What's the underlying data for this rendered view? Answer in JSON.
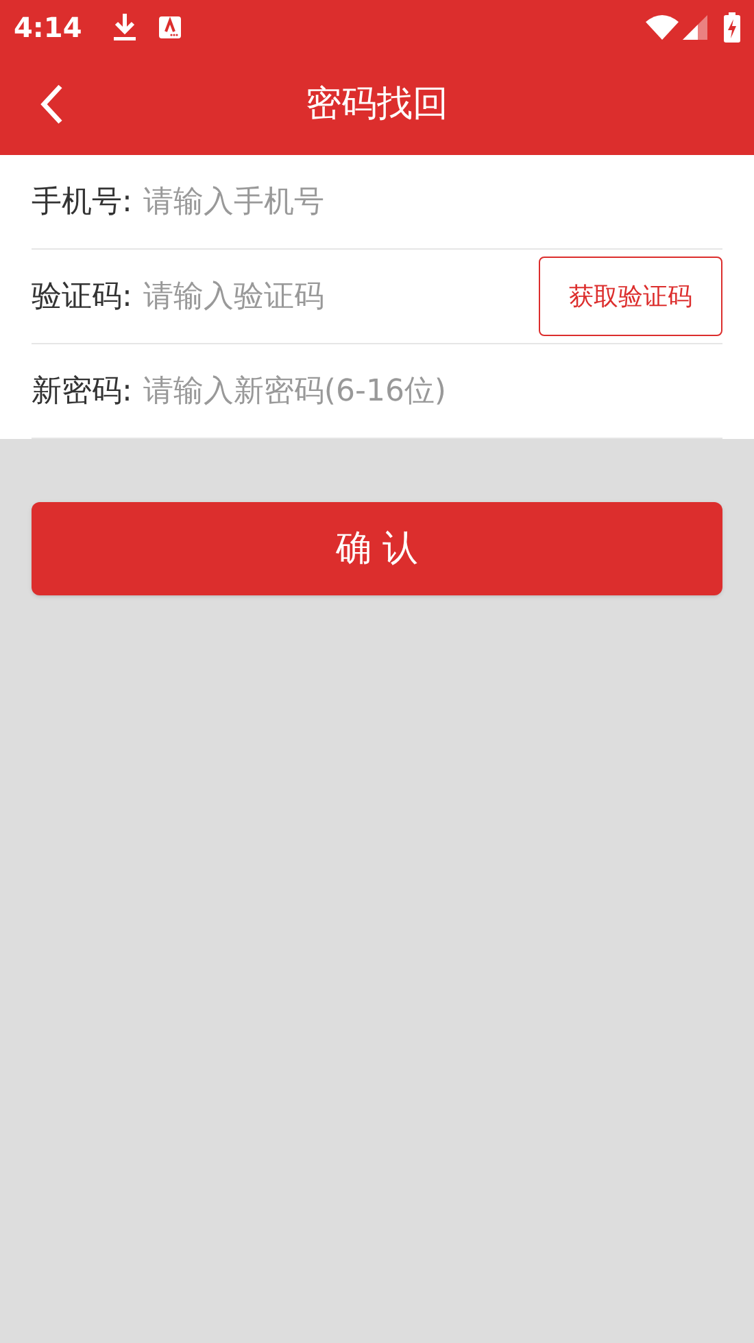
{
  "status_bar": {
    "time": "4:14"
  },
  "header": {
    "title": "密码找回"
  },
  "fields": [
    {
      "kind": "plain",
      "label": "手机号:",
      "placeholder": "请输入手机号"
    },
    {
      "kind": "code",
      "label": "验证码:",
      "placeholder": "请输入验证码",
      "button": "获取验证码"
    },
    {
      "kind": "plain",
      "label": "新密码:",
      "placeholder": "请输入新密码(6-16位)"
    }
  ],
  "submit": "确 认"
}
